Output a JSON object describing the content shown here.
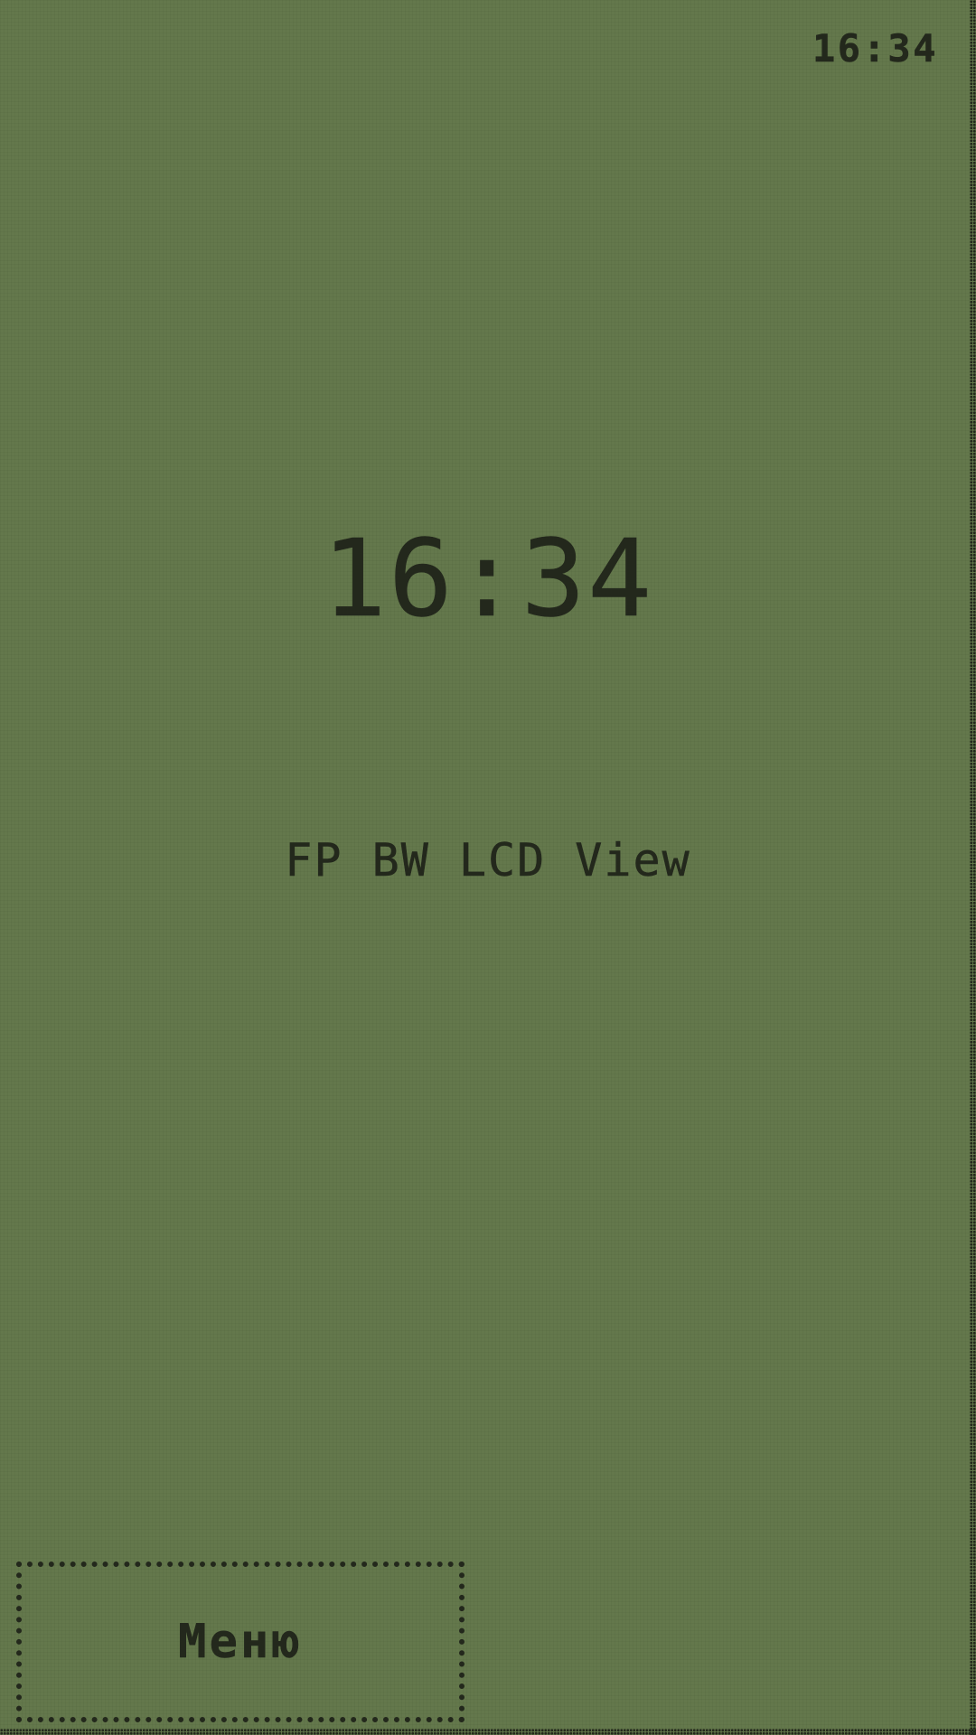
{
  "status_bar": {
    "time": "16:34"
  },
  "main": {
    "clock": "16:34",
    "subtitle": "FP BW LCD View"
  },
  "softkeys": {
    "left_label": "Меню"
  },
  "colors": {
    "lcd_background": "#64784c",
    "pixel": "#23281c"
  }
}
